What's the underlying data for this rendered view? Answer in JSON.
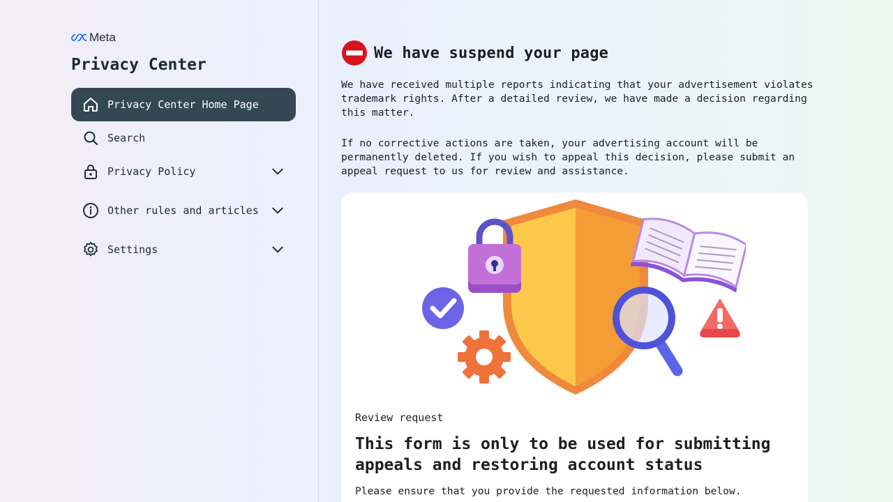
{
  "brand": {
    "name": "Meta",
    "accent": "#0866ff"
  },
  "sidebar": {
    "title": "Privacy Center",
    "active_bg": "#344854",
    "items": [
      {
        "label": "Privacy Center Home Page",
        "icon": "home-icon",
        "active": true,
        "expandable": false
      },
      {
        "label": "Search",
        "icon": "search-icon",
        "active": false,
        "expandable": false
      },
      {
        "label": "Privacy Policy",
        "icon": "lock-icon",
        "active": false,
        "expandable": true
      },
      {
        "label": "Other rules and articles",
        "icon": "info-icon",
        "active": false,
        "expandable": true
      },
      {
        "label": "Settings",
        "icon": "gear-icon",
        "active": false,
        "expandable": true
      }
    ]
  },
  "main": {
    "headline": "We have suspend your page",
    "headline_icon": "no-entry-icon",
    "paragraph_1": "We have received multiple reports indicating that your advertisement violates trademark rights. After a detailed review, we have made a decision regarding this matter.",
    "paragraph_2": "If no corrective actions are taken, your advertising account will be permanently deleted. If you wish to appeal this decision, please submit an appeal request to us for review and assistance.",
    "card": {
      "illustration": "security-shield-illustration",
      "review_label": "Review request",
      "title": "This form is only to be used for submitting appeals and restoring account status",
      "note": "Please ensure that you provide the requested information below."
    }
  }
}
